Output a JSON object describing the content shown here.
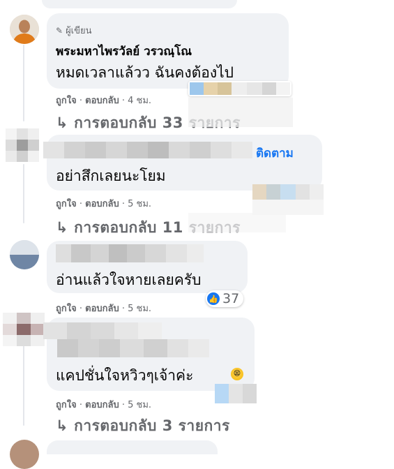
{
  "colors": {
    "bubble": "#f0f2f5",
    "meta_text": "#65676b",
    "link_blue": "#1877f2",
    "thread_line": "#e4e6eb"
  },
  "comment1": {
    "badge": "ผู้เขียน",
    "badge_icon": "pencil-icon",
    "author": "พระมหาไพรวัลย์ วรวณฺโณ",
    "text": "หมดเวลาแล้วว ฉันคงต้องไป",
    "actions": {
      "like": "ถูกใจ",
      "reply": "ตอบกลับ",
      "time": "4 ชม."
    },
    "reply_link": "การตอบกลับ 33 รายการ"
  },
  "comment2": {
    "follow": "ติดตาม",
    "text": "อย่าสึกเลยนะโยม",
    "actions": {
      "like": "ถูกใจ",
      "reply": "ตอบกลับ",
      "time": "5 ชม."
    },
    "reply_link": "การตอบกลับ 11 รายการ"
  },
  "comment3": {
    "text": "อ่านแล้วใจหายเลยครับ",
    "actions": {
      "like": "ถูกใจ",
      "reply": "ตอบกลับ",
      "time": "5 ชม."
    },
    "reactions": {
      "icon": "like-icon",
      "count": "37"
    }
  },
  "comment4": {
    "text": "แคปชั่นใจหวิวๆเจ้าค่ะ",
    "emoji_icon": "tired-face-emoji-icon",
    "actions": {
      "like": "ถูกใจ",
      "reply": "ตอบกลับ",
      "time": "5 ชม."
    },
    "reply_link": "การตอบกลับ 3 รายการ"
  },
  "separator": "·"
}
